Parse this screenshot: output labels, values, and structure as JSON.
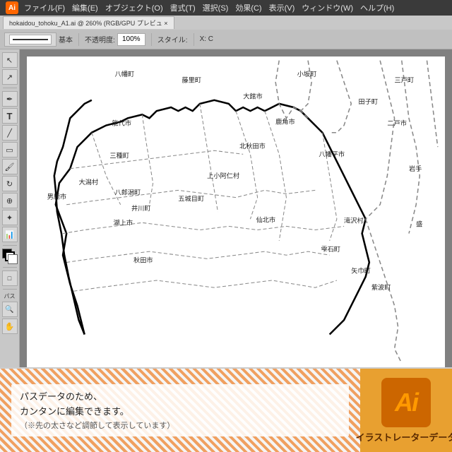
{
  "titleBar": {
    "logo": "Ai",
    "menuItems": [
      "ファイル(F)",
      "編集(E)",
      "オブジェクト(O)",
      "書式(T)",
      "選択(S)",
      "効果(C)",
      "表示(V)",
      "ウィンドウ(W)",
      "ヘルプ(H)"
    ]
  },
  "tab": {
    "filename": "hokaidou_tohoku_A1.ai @ 260% (RGB/GPU プレビュ ×"
  },
  "toolbar": {
    "strokeLabel": "基本",
    "opacityLabel": "不透明度:",
    "opacityValue": "100%",
    "styleLabel": "スタイル:",
    "xLabel": "X: C"
  },
  "leftTools": {
    "pathsLabel": "パス"
  },
  "mapLabels": [
    {
      "text": "八幡町",
      "x": "21%",
      "y": "5%"
    },
    {
      "text": "藤里町",
      "x": "37%",
      "y": "8%"
    },
    {
      "text": "小坂町",
      "x": "65%",
      "y": "5%"
    },
    {
      "text": "三戸町",
      "x": "89%",
      "y": "8%"
    },
    {
      "text": "大館市",
      "x": "52%",
      "y": "13%"
    },
    {
      "text": "田子町",
      "x": "80%",
      "y": "15%"
    },
    {
      "text": "鹿角市",
      "x": "60%",
      "y": "22%"
    },
    {
      "text": "二戸市",
      "x": "86%",
      "y": "22%"
    },
    {
      "text": "能代市",
      "x": "21%",
      "y": "22%"
    },
    {
      "text": "三種町",
      "x": "20%",
      "y": "33%"
    },
    {
      "text": "北秋田市",
      "x": "52%",
      "y": "30%"
    },
    {
      "text": "八幡平市",
      "x": "71%",
      "y": "33%"
    },
    {
      "text": "岩手",
      "x": "90%",
      "y": "38%"
    },
    {
      "text": "大潟村",
      "x": "13%",
      "y": "42%"
    },
    {
      "text": "上小阿仁村",
      "x": "44%",
      "y": "40%"
    },
    {
      "text": "五城目町",
      "x": "37%",
      "y": "47%"
    },
    {
      "text": "八郎潟町",
      "x": "22%",
      "y": "46%"
    },
    {
      "text": "井川町",
      "x": "26%",
      "y": "51%"
    },
    {
      "text": "湖上市",
      "x": "21%",
      "y": "56%"
    },
    {
      "text": "男鹿市",
      "x": "5%",
      "y": "47%"
    },
    {
      "text": "秋田市",
      "x": "26%",
      "y": "68%"
    },
    {
      "text": "仙北市",
      "x": "56%",
      "y": "55%"
    },
    {
      "text": "滝沢村",
      "x": "77%",
      "y": "55%"
    },
    {
      "text": "盛",
      "x": "92%",
      "y": "55%"
    },
    {
      "text": "雫石町",
      "x": "70%",
      "y": "65%"
    },
    {
      "text": "矢巾町",
      "x": "77%",
      "y": "72%"
    },
    {
      "text": "紫波町",
      "x": "82%",
      "y": "78%"
    }
  ],
  "bottomPanel": {
    "line1": "パスデータのため、",
    "line2": "カンタンに編集できます。",
    "line3": "（※先の太さなど調節して表示しています）",
    "caption": "イラストレーターデータ",
    "aiLogo": "Ai"
  }
}
